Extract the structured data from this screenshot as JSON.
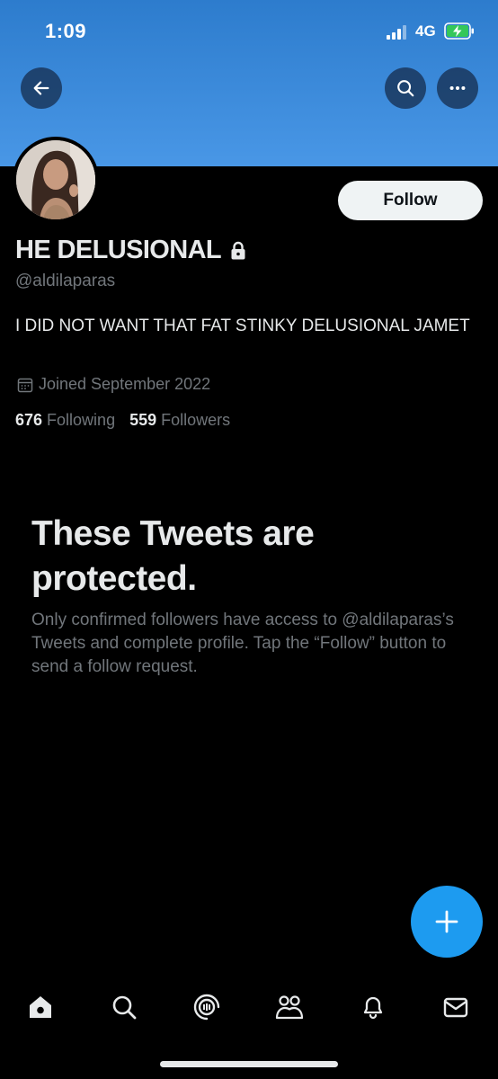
{
  "status_bar": {
    "time": "1:09",
    "network": "4G",
    "battery_charging": true,
    "battery_color": "#34c759"
  },
  "header": {
    "banner_color": "#4997e6",
    "back_icon": "arrow-left-icon",
    "search_icon": "search-icon",
    "more_icon": "more-horizontal-icon"
  },
  "profile": {
    "display_name": "HE DELUSIONAL",
    "protected_icon": "lock-icon",
    "handle": "@aldilaparas",
    "follow_label": "Follow",
    "bio": "I DID NOT WANT THAT FAT STINKY DELUSIONAL JAMET",
    "joined": "Joined September 2022",
    "following_count": "676",
    "following_label": "Following",
    "followers_count": "559",
    "followers_label": "Followers"
  },
  "protected": {
    "title": "These Tweets are protected.",
    "description": "Only confirmed followers have access to @aldilaparas’s Tweets and complete profile. Tap the “Follow” button to send a follow request."
  },
  "fab": {
    "icon": "plus-icon",
    "color": "#1d9bf0"
  },
  "tabbar": {
    "items": [
      "home-icon",
      "search-icon",
      "spaces-icon",
      "communities-icon",
      "notifications-icon",
      "messages-icon"
    ]
  }
}
